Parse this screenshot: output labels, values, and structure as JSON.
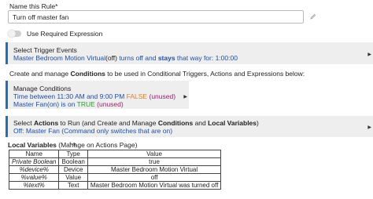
{
  "rule_name": {
    "label": "Name this Rule*",
    "value": "Turn off master fan"
  },
  "required_expression": {
    "label": "Use Required Expression",
    "enabled": false
  },
  "trigger": {
    "title": "Select Trigger Events",
    "device": "Master Bedroom Motion Virtual",
    "state": "(off)",
    "mid": " turns off and ",
    "stays": "stays",
    "end": " that way for: 1:00:00"
  },
  "create_instructions": {
    "pre": "Create and manage ",
    "bold": "Conditions",
    "post": " to be used in Conditional Triggers, Actions and Expressions below:"
  },
  "conditions": {
    "title": "Manage Conditions",
    "line1_text": "Time between 11:30 AM and 9:00 PM ",
    "line1_status": "FALSE",
    "line1_unused": "(unused)",
    "line2_text": "Master Fan(on) is on ",
    "line2_status": "TRUE",
    "line2_unused": "(unused)"
  },
  "actions": {
    "title_pre": "Select ",
    "title_b1": "Actions",
    "title_mid": " to Run (and Create and Manage ",
    "title_b2": "Conditions",
    "title_and": " and ",
    "title_b3": "Local Variables",
    "title_end": ")",
    "line": "Off: Master Fan (Command only switches that are on)"
  },
  "local_variables": {
    "header_bold": "Local Variables",
    "header_link": " (Manage on Actions Page)",
    "columns": [
      "Name",
      "Type",
      "Value"
    ],
    "rows": [
      [
        "Private Boolean",
        "Boolean",
        "true"
      ],
      [
        "%device%",
        "Device",
        "Master Bedroom Motion Virtual"
      ],
      [
        "%value%",
        "Value",
        "off"
      ],
      [
        "%text%",
        "Text",
        "Master Bedroom Motion Virtual was turned off"
      ]
    ]
  },
  "colors": {
    "accent": "#1e6fbf",
    "link_blue": "#1d4fa8",
    "false_orange": "#d9822b",
    "true_green": "#2c9a2c",
    "unused_magenta": "#a01f6c",
    "card_bg": "#eeeeee"
  },
  "icons": [
    "pencil-icon",
    "chevron-right-icon",
    "cursor-icon"
  ]
}
